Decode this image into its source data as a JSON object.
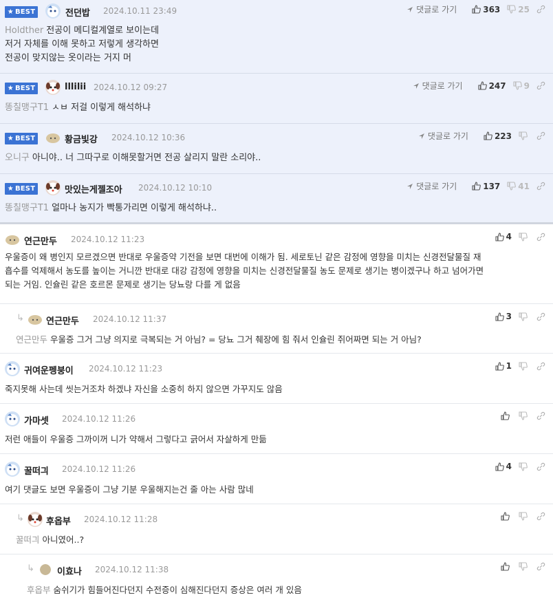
{
  "best_label": "BEST",
  "goto_label": "댓글로 가기",
  "best_comments": [
    {
      "nick": "전던밥",
      "date": "2024.10.11 23:49",
      "up": "363",
      "down": "25",
      "mention": "Holdther",
      "lines": [
        "전공이 메디컬계열로 보이는데",
        "저거 자체를 이해 못하고 저렇게 생각하면",
        "전공이 맞지않는 옷이라는 거지 머"
      ],
      "avatar": "bluepet"
    },
    {
      "nick": "lllilii",
      "date": "2024.10.12 09:27",
      "up": "247",
      "down": "9",
      "mention": "똥칠맹구T1",
      "lines": [
        "ㅅㅂ 저걸 이렇게 해석하냐"
      ],
      "avatar": "dog"
    },
    {
      "nick": "황금빛강",
      "date": "2024.10.12 10:36",
      "up": "223",
      "down": "",
      "mention": "오니구",
      "lines": [
        "아니야.. 너 그따구로 이해못할거면 전공 살리지 말란 소리야.."
      ],
      "avatar": "beige"
    },
    {
      "nick": "맛있는게젤조아",
      "date": "2024.10.12 10:10",
      "up": "137",
      "down": "41",
      "mention": "똥칠맹구T1",
      "lines": [
        "얼마나 농지가 빡통가리면 이렇게 해석하냐.."
      ],
      "avatar": "dog"
    }
  ],
  "comments": [
    {
      "nick": "연근만두",
      "date": "2024.10.12 11:23",
      "up": "4",
      "mention": "",
      "lines": [
        "우울증이 왜 병인지 모르겠으면 반대로 우울증약 기전을 보면 대번에 이해가 됨. 세로토닌 같은 감정에 영향을 미치는 신경전달물질 재",
        "흡수를 억제해서 농도를 높이는 거니깐 반대로 대강 감정에 영향을 미치는 신경전달물질 농도 문제로 생기는 병이겠구나 하고 넘어가면",
        "되는 거임. 인슐린 같은 호르몬 문제로 생기는 당뇨랑 다를 게 없음"
      ],
      "avatar": "beige"
    },
    {
      "nick": "연근만두",
      "date": "2024.10.12 11:37",
      "up": "3",
      "mention": "연근만두",
      "lines": [
        "우울증 그거 그냥 의지로 극복되는 거 아님? = 당뇨 그거 췌장에 힘 줘서 인슐린 쥐어짜면 되는 거 아님?"
      ],
      "avatar": "beige"
    },
    {
      "nick": "귀여운펭붕이",
      "date": "2024.10.12 11:23",
      "up": "1",
      "mention": "",
      "lines": [
        "죽지못해 사는데 씻는거조차 하겠냐 자신을 소중히 하지 않으면 가꾸지도 않음"
      ],
      "avatar": "bluepet"
    },
    {
      "nick": "가마셋",
      "date": "2024.10.12 11:26",
      "up": "",
      "mention": "",
      "lines": [
        "저런 애들이 우울증 그까이꺼 니가 약해서 그렇다고 긁어서 자살하게 만듦"
      ],
      "avatar": "bluepet"
    },
    {
      "nick": "꿀떠긔",
      "date": "2024.10.12 11:26",
      "up": "4",
      "mention": "",
      "lines": [
        "여기 댓글도 보면 우울증이 그냥 기분 우울해지는건 줄 아는 사람 많네"
      ],
      "avatar": "bluepet"
    },
    {
      "nick": "후옵부",
      "date": "2024.10.12 11:28",
      "up": "",
      "mention": "꿀떠긔",
      "lines": [
        "아니였어..?"
      ],
      "avatar": "dog"
    },
    {
      "nick": "이효나",
      "date": "2024.10.12 11:38",
      "up": "",
      "mention": "후옵부",
      "lines": [
        "숨쉬기가 힘들어진다던지 수전증이 심해진다던지 증상은 여러 개 있음"
      ],
      "avatar": "tan"
    }
  ]
}
